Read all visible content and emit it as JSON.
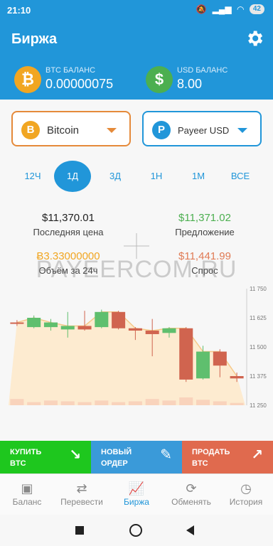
{
  "status": {
    "time": "21:10",
    "battery": "42"
  },
  "appbar": {
    "title": "Биржа"
  },
  "balances": [
    {
      "label": "BTC БАЛАНС",
      "value": "0.00000075",
      "symbol": "₿",
      "color": "#f1a622"
    },
    {
      "label": "USD БАЛАНС",
      "value": "8.00",
      "symbol": "$",
      "color": "#4caf50"
    }
  ],
  "selectors": [
    {
      "label": "Bitcoin",
      "symbol": "B",
      "color": "#f1a622",
      "border": "#e58a3a",
      "caret": "#e58a3a"
    },
    {
      "label": "Payeer USD",
      "symbol": "P",
      "color": "#2196d9",
      "border": "#2196d9",
      "caret": "#2196d9"
    }
  ],
  "periods": [
    "12Ч",
    "1Д",
    "3Д",
    "1Н",
    "1М",
    "ВСЕ"
  ],
  "active_period": "1Д",
  "stats": [
    {
      "value": "$11,370.01",
      "label": "Последняя цена",
      "color": "#222222"
    },
    {
      "value": "$11,371.02",
      "label": "Предложение",
      "color": "#4caf50"
    },
    {
      "value": "Ƀ3.33000000",
      "label": "Объём за 24ч",
      "color": "#f1a622"
    },
    {
      "value": "$11,441.99",
      "label": "Спрос",
      "color": "#e07b55"
    }
  ],
  "watermark": "PAYEERCOM.RU",
  "chart_data": {
    "type": "candlestick",
    "y_ticks": [
      "11 750",
      "11 625",
      "11 500",
      "11 375",
      "11 250"
    ],
    "ylim": [
      11250,
      11750
    ],
    "candles": [
      {
        "o": 11605,
        "c": 11600,
        "h": 11615,
        "l": 11590
      },
      {
        "o": 11585,
        "c": 11625,
        "h": 11635,
        "l": 11580
      },
      {
        "o": 11585,
        "c": 11605,
        "h": 11620,
        "l": 11570
      },
      {
        "o": 11575,
        "c": 11590,
        "h": 11650,
        "l": 11540
      },
      {
        "o": 11590,
        "c": 11575,
        "h": 11655,
        "l": 11570
      },
      {
        "o": 11585,
        "c": 11650,
        "h": 11660,
        "l": 11580
      },
      {
        "o": 11650,
        "c": 11580,
        "h": 11655,
        "l": 11575
      },
      {
        "o": 11580,
        "c": 11570,
        "h": 11585,
        "l": 11530
      },
      {
        "o": 11570,
        "c": 11555,
        "h": 11620,
        "l": 11460
      },
      {
        "o": 11560,
        "c": 11580,
        "h": 11585,
        "l": 11540
      },
      {
        "o": 11580,
        "c": 11360,
        "h": 11585,
        "l": 11350
      },
      {
        "o": 11365,
        "c": 11480,
        "h": 11505,
        "l": 11360
      },
      {
        "o": 11480,
        "c": 11420,
        "h": 11490,
        "l": 11370
      },
      {
        "o": 11375,
        "c": 11365,
        "h": 11390,
        "l": 11350
      }
    ],
    "volumes": [
      0.4,
      0.2,
      0.3,
      0.25,
      0.2,
      0.3,
      0.2,
      0.25,
      0.4,
      0.3,
      0.5,
      0.35,
      0.25,
      0.15
    ]
  },
  "actions": [
    {
      "line1": "КУПИТЬ",
      "line2": "BTC",
      "icon": "↘",
      "color": "#1ec71e"
    },
    {
      "line1": "НОВЫЙ",
      "line2": "ОРДЕР",
      "icon": "✎",
      "color": "#3a9ad9"
    },
    {
      "line1": "ПРОДАТЬ",
      "line2": "BTC",
      "icon": "↗",
      "color": "#e06a4e"
    }
  ],
  "nav": [
    {
      "label": "Баланс",
      "icon": "▣"
    },
    {
      "label": "Перевести",
      "icon": "⇄"
    },
    {
      "label": "Биржа",
      "icon": "📈"
    },
    {
      "label": "Обменять",
      "icon": "⟳"
    },
    {
      "label": "История",
      "icon": "◷"
    }
  ],
  "active_nav": "Биржа"
}
